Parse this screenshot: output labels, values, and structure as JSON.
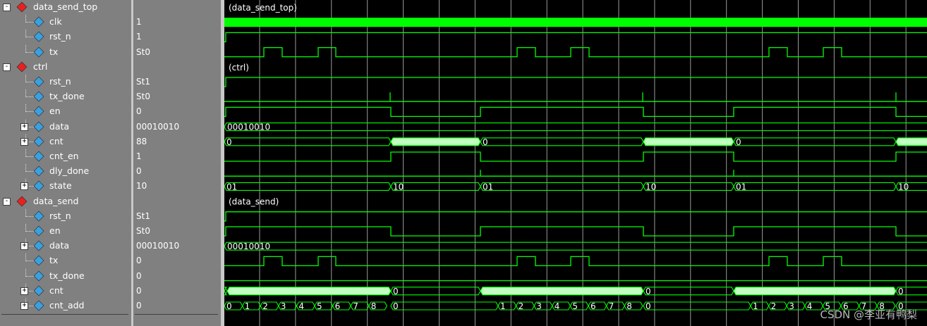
{
  "signals": [
    {
      "name": "data_send_top",
      "value": "",
      "kind": "group",
      "level": 0,
      "expand": "-"
    },
    {
      "name": "clk",
      "value": "1",
      "kind": "signal",
      "level": 1
    },
    {
      "name": "rst_n",
      "value": "1",
      "kind": "signal",
      "level": 1
    },
    {
      "name": "tx",
      "value": "St0",
      "kind": "signal",
      "level": 1
    },
    {
      "name": "ctrl",
      "value": "",
      "kind": "group",
      "level": 0,
      "expand": "-"
    },
    {
      "name": "rst_n",
      "value": "St1",
      "kind": "signal",
      "level": 1
    },
    {
      "name": "tx_done",
      "value": "St0",
      "kind": "signal",
      "level": 1
    },
    {
      "name": "en",
      "value": "0",
      "kind": "signal",
      "level": 1
    },
    {
      "name": "data",
      "value": "00010010",
      "kind": "bus",
      "level": 1,
      "expand": "+"
    },
    {
      "name": "cnt",
      "value": "88",
      "kind": "bus",
      "level": 1,
      "expand": "+"
    },
    {
      "name": "cnt_en",
      "value": "1",
      "kind": "signal",
      "level": 1
    },
    {
      "name": "dly_done",
      "value": "0",
      "kind": "signal",
      "level": 1
    },
    {
      "name": "state",
      "value": "10",
      "kind": "bus",
      "level": 1,
      "expand": "+"
    },
    {
      "name": "data_send",
      "value": "",
      "kind": "group",
      "level": 0,
      "expand": "-"
    },
    {
      "name": "rst_n",
      "value": "St1",
      "kind": "signal",
      "level": 1
    },
    {
      "name": "en",
      "value": "St0",
      "kind": "signal",
      "level": 1
    },
    {
      "name": "data",
      "value": "00010010",
      "kind": "bus",
      "level": 1,
      "expand": "+"
    },
    {
      "name": "tx",
      "value": "0",
      "kind": "signal",
      "level": 1
    },
    {
      "name": "tx_done",
      "value": "0",
      "kind": "signal",
      "level": 1
    },
    {
      "name": "cnt",
      "value": "0",
      "kind": "bus",
      "level": 1,
      "expand": "+"
    },
    {
      "name": "cnt_add",
      "value": "0",
      "kind": "bus",
      "level": 1,
      "expand": "+"
    }
  ],
  "group_labels": [
    "(data_send_top)",
    "(ctrl)",
    "(data_send)"
  ],
  "bus_labels": {
    "data": "00010010",
    "cnt_ctrl": [
      "0",
      "0",
      "0"
    ],
    "state": [
      "01",
      "10",
      "01",
      "10",
      "01",
      "10"
    ],
    "cnt_send": "0",
    "cnt_add": [
      "0",
      "1",
      "2",
      "3",
      "4",
      "5",
      "6",
      "7",
      "8",
      "0"
    ]
  },
  "colors": {
    "wave": "#00ff00",
    "bus_fill": "#c0ffc0",
    "grid": "#9a9a9a",
    "group_icon": "#e82020",
    "signal_icon": "#3aa0e0",
    "panel_bg": "#808080",
    "canvas_bg": "#000000"
  },
  "watermark": "CSDN @李亚有鸭梨"
}
